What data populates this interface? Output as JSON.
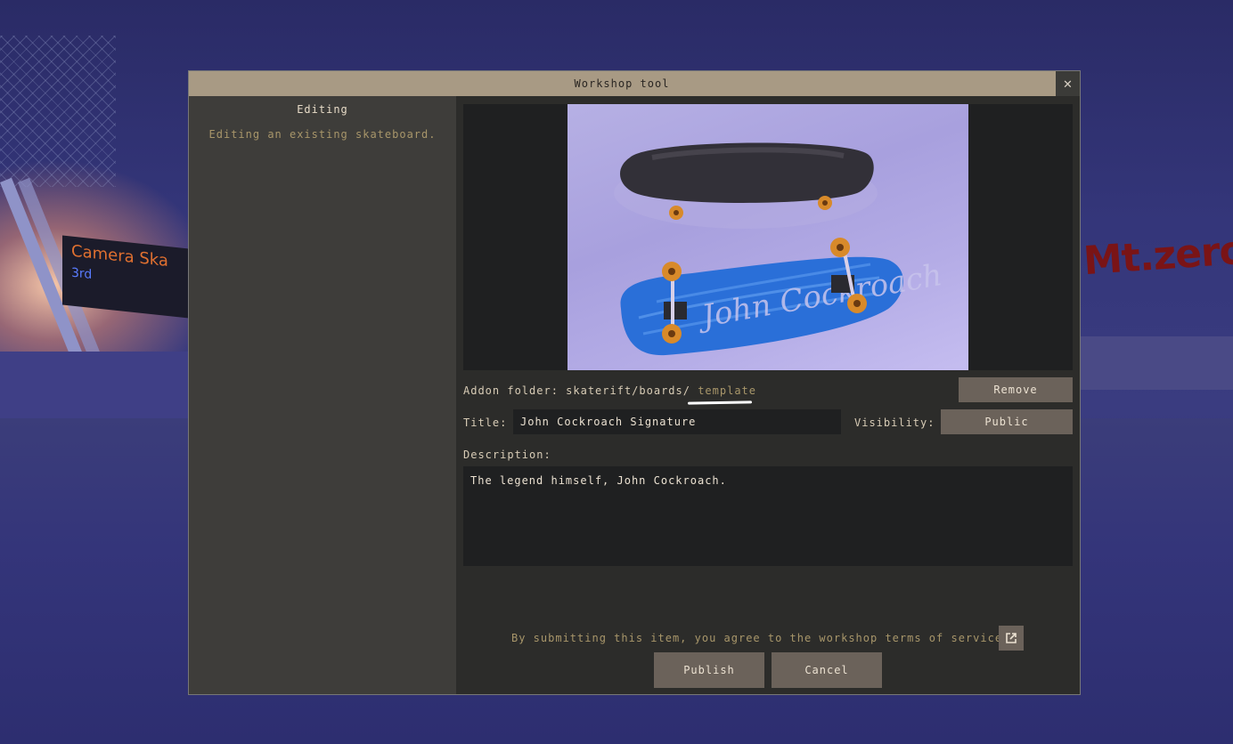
{
  "window": {
    "title": "Workshop tool",
    "close_glyph": "✕"
  },
  "sidebar": {
    "heading": "Editing",
    "description": "Editing an existing skateboard."
  },
  "preview": {
    "alt": "skateboard preview",
    "board_signature": "John Cockroach"
  },
  "addon": {
    "label": "Addon folder: skaterift/boards/",
    "folder": "template",
    "remove_label": "Remove"
  },
  "fields": {
    "title_label": "Title:",
    "title_value": "John Cockroach Signature",
    "visibility_label": "Visibility:",
    "visibility_value": "Public",
    "description_label": "Description:",
    "description_value": "The legend himself, John Cockroach."
  },
  "footer": {
    "terms_text": "By submitting this item, you agree to the workshop terms of service",
    "terms_icon": "external-link-icon",
    "publish_label": "Publish",
    "cancel_label": "Cancel"
  },
  "background": {
    "sign_text_1": "Camera  Ska",
    "sign_text_2": "3rd",
    "graffiti_text": "Mt.zero"
  },
  "colors": {
    "titlebar": "#a89a84",
    "button": "#6b625a",
    "panel": "#2c2c2a",
    "sidebar": "#3e3d3a",
    "accent_text": "#a8966a"
  }
}
